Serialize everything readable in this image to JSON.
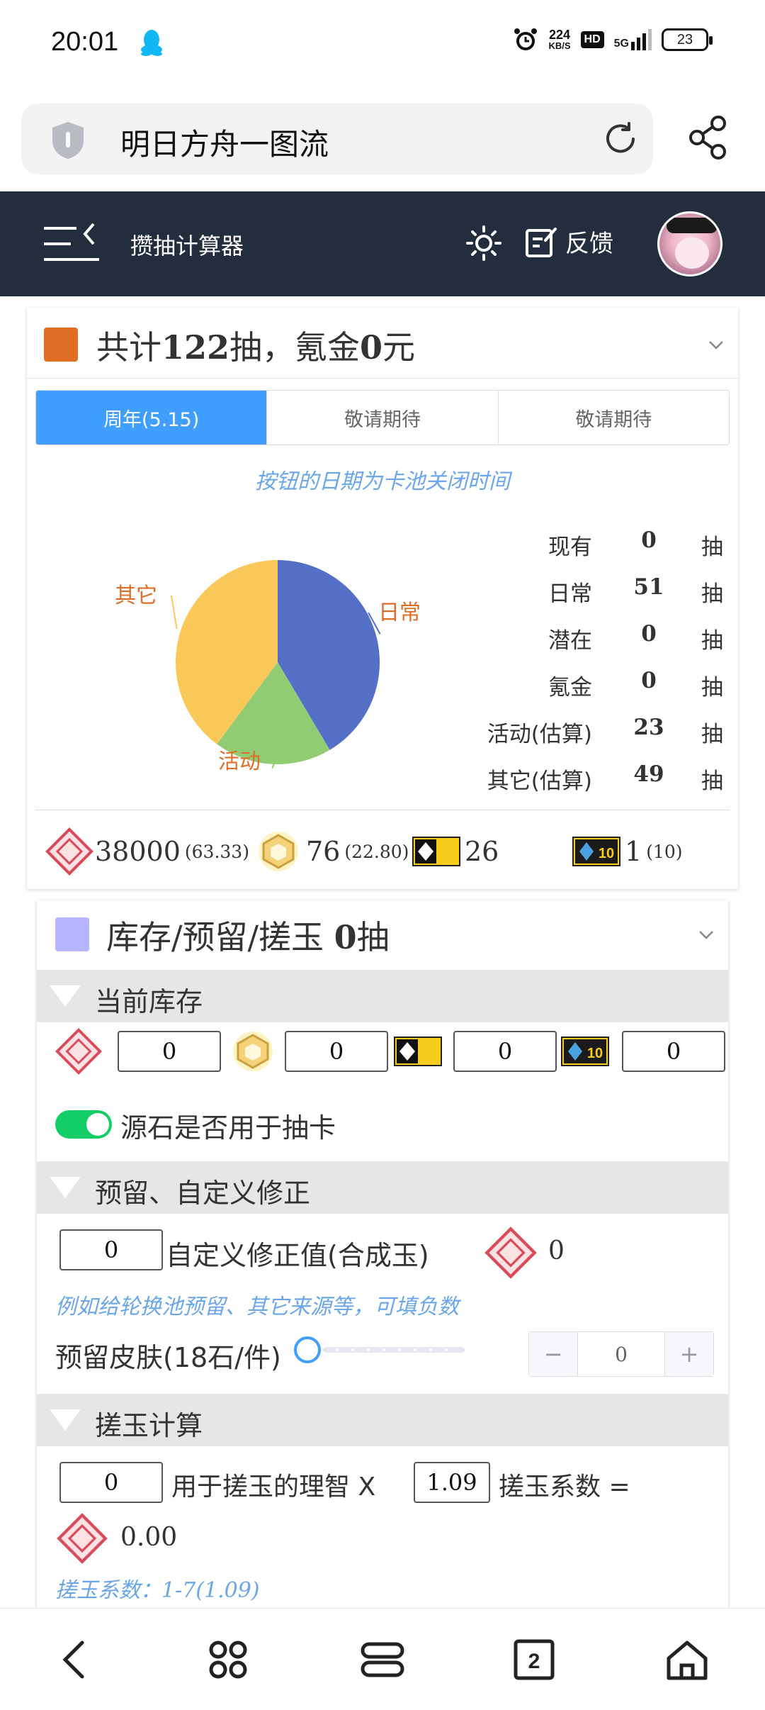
{
  "status_bar": {
    "time": "20:01",
    "speed_value": "224",
    "speed_unit": "KB/S",
    "hd": "HD",
    "network": "5G",
    "battery": "23"
  },
  "browser": {
    "page_title": "明日方舟一图流"
  },
  "app_header": {
    "title": "攒抽计算器",
    "feedback_label": "反馈"
  },
  "summary": {
    "title_prefix": "共计",
    "pulls": "122",
    "title_mid": "抽，氪金",
    "money": "0",
    "title_suffix": "元",
    "color": "#e06d24"
  },
  "tabs": [
    {
      "label": "周年(5.15)",
      "active": true
    },
    {
      "label": "敬请期待",
      "active": false
    },
    {
      "label": "敬请期待",
      "active": false
    }
  ],
  "tab_hint": "按钮的日期为卡池关闭时间",
  "chart_data": {
    "type": "pie",
    "labels": [
      "日常",
      "活动",
      "其它"
    ],
    "values": [
      51,
      23,
      49
    ],
    "colors": [
      "#5470c6",
      "#91cc75",
      "#fac858"
    ],
    "label_color": "#e06d24"
  },
  "stats": [
    {
      "label": "现有",
      "value": "0",
      "unit": "抽"
    },
    {
      "label": "日常",
      "value": "51",
      "unit": "抽"
    },
    {
      "label": "潜在",
      "value": "0",
      "unit": "抽"
    },
    {
      "label": "氪金",
      "value": "0",
      "unit": "抽"
    },
    {
      "label": "活动(估算)",
      "value": "23",
      "unit": "抽"
    },
    {
      "label": "其它(估算)",
      "value": "49",
      "unit": "抽"
    }
  ],
  "resources": {
    "orundum": "38000",
    "orundum_pulls": "(63.33)",
    "originium": "76",
    "originium_pulls": "(22.80)",
    "ticket": "26",
    "ten_ticket_icon": "10",
    "ten_ticket": "1",
    "ten_ticket_pulls": "(10)"
  },
  "inventory": {
    "title_prefix": "库存/预留/搓玉 ",
    "pulls": "0",
    "title_suffix": "抽",
    "color": "#b4b4ff",
    "current_section": "当前库存",
    "values": [
      "0",
      "0",
      "0",
      "0"
    ],
    "toggle_label": "源石是否用于抽卡",
    "toggle_on": true
  },
  "reserve": {
    "section": "预留、自定义修正",
    "custom_value": "0",
    "custom_label": "自定义修正值(合成玉)",
    "custom_result": "0",
    "hint": "例如给轮换池预留、其它来源等，可填负数",
    "skin_label": "预留皮肤(18石/件)",
    "skin_value": "0",
    "minus": "−",
    "plus": "+"
  },
  "grind": {
    "section": "搓玉计算",
    "sanity_value": "0",
    "sanity_label": "用于搓玉的理智 X",
    "coef_value": "1.09",
    "coef_label": "搓玉系数 =",
    "result": "0.00",
    "hint": "搓玉系数：1-7(1.09)"
  }
}
